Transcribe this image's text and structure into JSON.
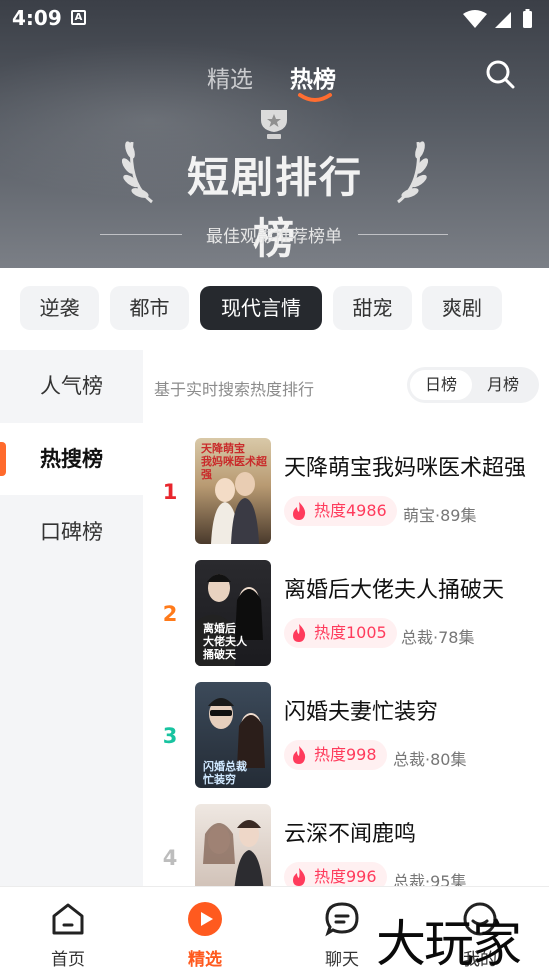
{
  "status_bar": {
    "time": "4:09",
    "notification_letter": "A"
  },
  "header": {
    "tabs": [
      {
        "label": "精选"
      },
      {
        "label": "热榜"
      }
    ],
    "banner_title": "短剧排行榜",
    "banner_subtitle": "最佳观影推荐榜单",
    "accent_color": "#ff6a2c"
  },
  "genres": [
    {
      "label": "逆袭",
      "active": false
    },
    {
      "label": "都市",
      "active": false
    },
    {
      "label": "现代言情",
      "active": true
    },
    {
      "label": "甜宠",
      "active": false
    },
    {
      "label": "爽剧",
      "active": false
    }
  ],
  "sidebar": {
    "items": [
      {
        "label": "人气榜",
        "active": false
      },
      {
        "label": "热搜榜",
        "active": true
      },
      {
        "label": "口碑榜",
        "active": false
      }
    ]
  },
  "content": {
    "hint": "基于实时搜索热度排行",
    "period_toggle": [
      {
        "label": "日榜",
        "active": true
      },
      {
        "label": "月榜",
        "active": false
      }
    ],
    "items": [
      {
        "rank": "1",
        "rank_color": "#e8262d",
        "title": "天降萌宝我妈咪医术超强",
        "heat": "热度4986",
        "meta": "萌宝·89集",
        "cover_text": "天降萌宝 我妈咪医术超强"
      },
      {
        "rank": "2",
        "rank_color": "#ff7a1a",
        "title": "离婚后大佬夫人捅破天",
        "heat": "热度1005",
        "meta": "总裁·78集",
        "cover_text": "离婚后 大佬夫人 捅破天"
      },
      {
        "rank": "3",
        "rank_color": "#18c3a0",
        "title": "闪婚夫妻忙装穷",
        "heat": "热度998",
        "meta": "总裁·80集",
        "cover_text": "闪婚总裁 忙装穷"
      },
      {
        "rank": "4",
        "rank_color": "#bdbdbd",
        "title": "云深不闻鹿鸣",
        "heat": "热度996",
        "meta": "总裁·95集",
        "cover_text": ""
      }
    ]
  },
  "bottom_nav": [
    {
      "label": "首页",
      "icon": "home-icon",
      "active": false
    },
    {
      "label": "精选",
      "icon": "play-icon",
      "active": true
    },
    {
      "label": "聊天",
      "icon": "chat-icon",
      "active": false
    },
    {
      "label": "我的",
      "icon": "profile-icon",
      "active": false
    }
  ],
  "watermark": "大玩家"
}
